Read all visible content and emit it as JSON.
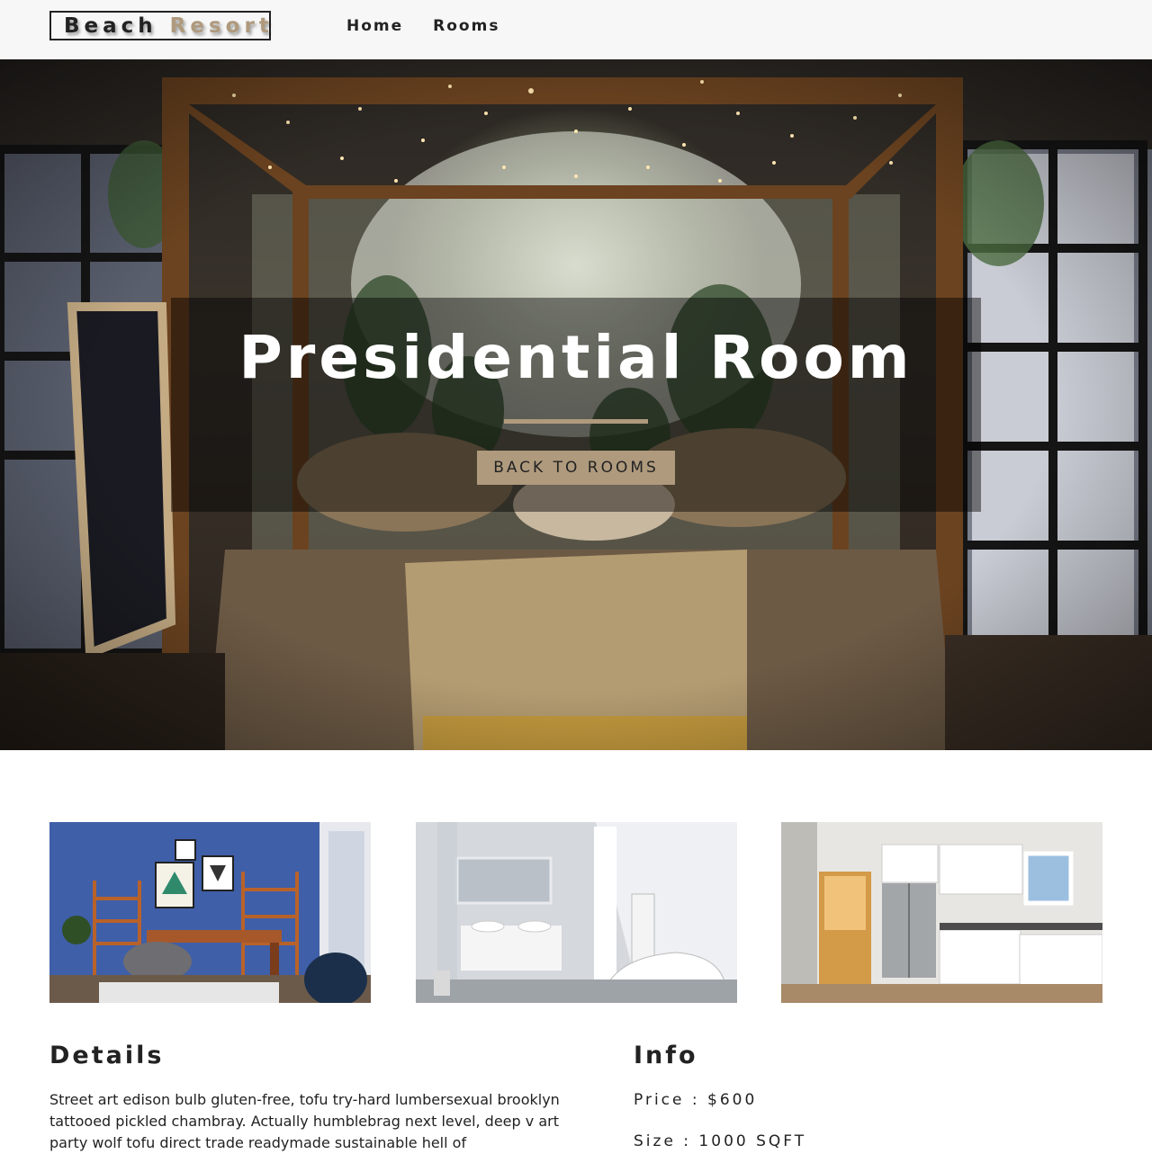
{
  "navbar": {
    "logo_word1": "Beach",
    "logo_word2": "Resort",
    "links": [
      {
        "label": "Home"
      },
      {
        "label": "Rooms"
      }
    ]
  },
  "hero": {
    "title": "Presidential Room",
    "button_label": "BACK TO ROOMS",
    "image": "bedroom-canopy-bed-photo"
  },
  "gallery": [
    {
      "image": "home-office-photo"
    },
    {
      "image": "bathroom-photo"
    },
    {
      "image": "kitchen-photo"
    }
  ],
  "details": {
    "heading": "Details",
    "text": "Street art edison bulb gluten-free, tofu try-hard lumbersexual brooklyn tattooed pickled chambray. Actually humblebrag next level, deep v art party wolf tofu direct trade readymade sustainable hell of"
  },
  "info": {
    "heading": "Info",
    "price": "Price : $600",
    "size": "Size : 1000 SQFT"
  },
  "colors": {
    "accent": "#af9a7d",
    "navbar_bg": "#f7f7f7",
    "text": "#222222"
  }
}
